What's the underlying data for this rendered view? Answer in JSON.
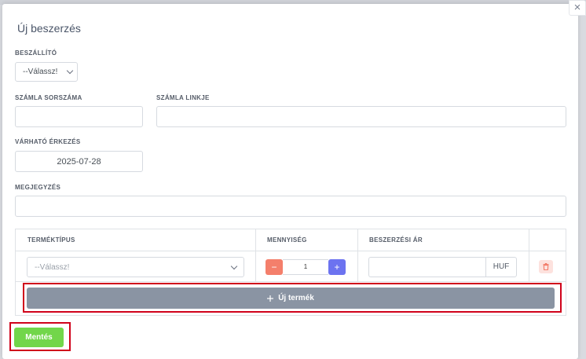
{
  "modal": {
    "title": "Új beszerzés",
    "close_glyph": "×"
  },
  "form": {
    "supplier": {
      "label": "BESZÁLLÍTÓ",
      "value": "--Válassz!"
    },
    "invoice_number": {
      "label": "SZÁMLA SORSZÁMA",
      "value": ""
    },
    "invoice_link": {
      "label": "SZÁMLA LINKJE",
      "value": ""
    },
    "expected_arrival": {
      "label": "VÁRHATÓ ÉRKEZÉS",
      "value": "2025-07-28"
    },
    "note": {
      "label": "MEGJEGYZÉS",
      "value": ""
    }
  },
  "table": {
    "headers": [
      "TERMÉKTÍPUS",
      "MENNYISÉG",
      "BESZERZÉSI ÁR"
    ],
    "rows": [
      {
        "product_type": "--Válassz!",
        "quantity": "1",
        "price": "",
        "currency": "HUF"
      }
    ],
    "minus_glyph": "−",
    "plus_glyph": "+",
    "new_product_label": "Új termék",
    "new_product_icon": "plus-icon"
  },
  "actions": {
    "save_label": "Mentés"
  },
  "colors": {
    "save": "#72d64a",
    "new_product": "#8a94a3",
    "minus": "#f47f6b",
    "plus": "#6c73f0",
    "highlight": "#d0021b"
  }
}
